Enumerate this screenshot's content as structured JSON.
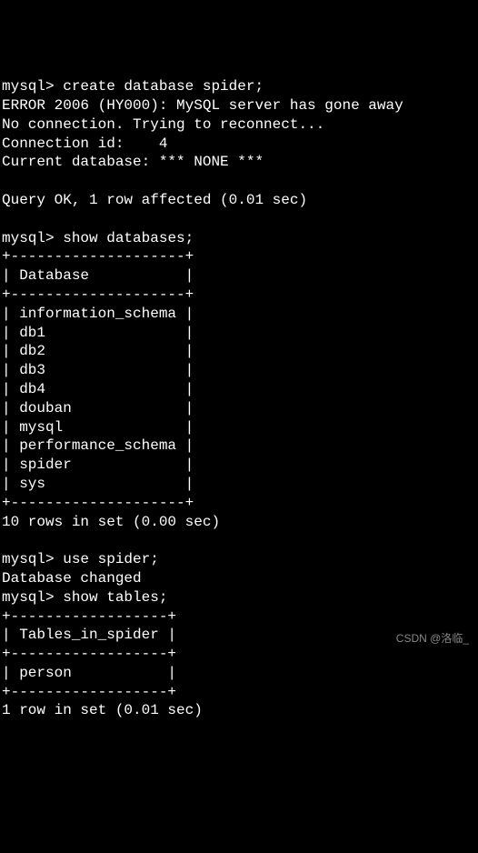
{
  "terminal": {
    "prompt": "mysql>",
    "block1": {
      "command": "create database spider;",
      "error": "ERROR 2006 (HY000): MySQL server has gone away",
      "reconnect1": "No connection. Trying to reconnect...",
      "reconnect2": "Connection id:    4",
      "reconnect3": "Current database: *** NONE ***",
      "blank": "",
      "result": "Query OK, 1 row affected (0.01 sec)"
    },
    "block2": {
      "command": "show databases;",
      "border_top": "+--------------------+",
      "header": "| Database           |",
      "border_mid": "+--------------------+",
      "row0": "| information_schema |",
      "row1": "| db1                |",
      "row2": "| db2                |",
      "row3": "| db3                |",
      "row4": "| db4                |",
      "row5": "| douban             |",
      "row6": "| mysql              |",
      "row7": "| performance_schema |",
      "row8": "| spider             |",
      "row9": "| sys                |",
      "border_bot": "+--------------------+",
      "result": "10 rows in set (0.00 sec)"
    },
    "block3": {
      "command": "use spider;",
      "result": "Database changed"
    },
    "block4": {
      "command": "show tables;",
      "border_top": "+------------------+",
      "header": "| Tables_in_spider |",
      "border_mid": "+------------------+",
      "row0": "| person           |",
      "border_bot": "+------------------+",
      "result": "1 row in set (0.01 sec)"
    }
  },
  "watermark": "CSDN @洛临_"
}
